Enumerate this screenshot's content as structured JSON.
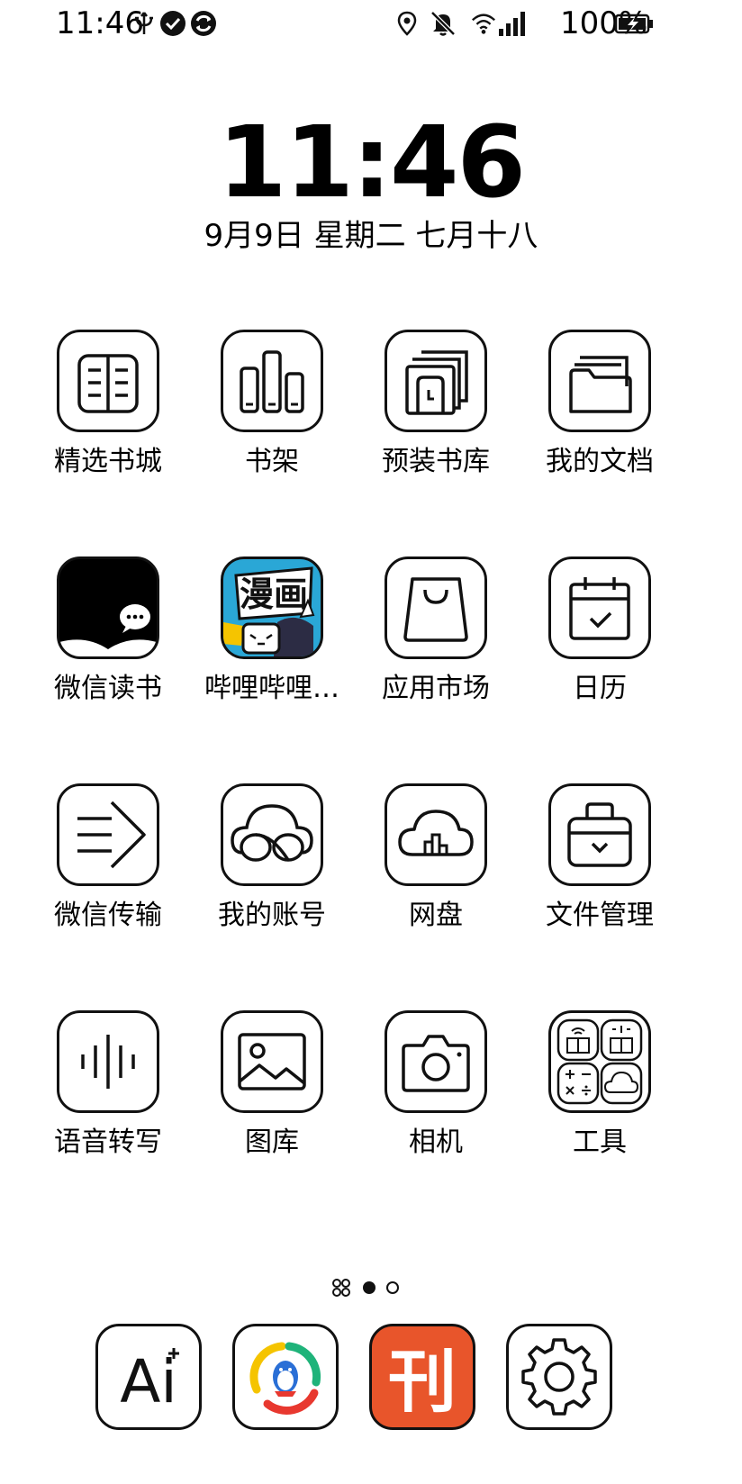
{
  "status_bar": {
    "time": "11:46",
    "battery": "100%",
    "icons": [
      "usb-icon",
      "check-circle-icon",
      "sync-circle-icon",
      "location-icon",
      "mute-bell-icon",
      "wifi-icon",
      "signal-icon",
      "battery-charging-icon"
    ]
  },
  "lock": {
    "clock": "11:46",
    "date": "9月9日 星期二 七月十八"
  },
  "apps": [
    {
      "label": "精选书城",
      "icon": "open-book-icon"
    },
    {
      "label": "书架",
      "icon": "bookshelf-icon"
    },
    {
      "label": "预装书库",
      "icon": "preinstalled-library-icon"
    },
    {
      "label": "我的文档",
      "icon": "folder-icon"
    },
    {
      "label": "微信读书",
      "icon": "wechat-read-icon"
    },
    {
      "label": "哔哩哔哩…",
      "icon": "bilibili-comics-icon"
    },
    {
      "label": "应用市场",
      "icon": "shopping-bag-icon"
    },
    {
      "label": "日历",
      "icon": "calendar-icon"
    },
    {
      "label": "微信传输",
      "icon": "arrow-transfer-icon"
    },
    {
      "label": "我的账号",
      "icon": "cloud-account-icon"
    },
    {
      "label": "网盘",
      "icon": "cloud-drive-icon"
    },
    {
      "label": "文件管理",
      "icon": "file-manager-icon"
    },
    {
      "label": "语音转写",
      "icon": "voice-wave-icon"
    },
    {
      "label": "图库",
      "icon": "gallery-icon"
    },
    {
      "label": "相机",
      "icon": "camera-icon"
    },
    {
      "label": "工具",
      "icon": "tools-folder-icon"
    }
  ],
  "bilibili_icon_text": "漫画",
  "dock": [
    {
      "icon": "ai-assistant-icon",
      "text": "Ai"
    },
    {
      "icon": "tencent-news-icon"
    },
    {
      "icon": "kan-app-icon",
      "text": "刊"
    },
    {
      "icon": "settings-gear-icon"
    }
  ],
  "colors": {
    "kan_orange": "#e8552b",
    "bili_blue": "#2aa7d6",
    "qq_yellow": "#f5c400",
    "qq_green": "#1fb37a",
    "qq_red": "#e8382f"
  }
}
